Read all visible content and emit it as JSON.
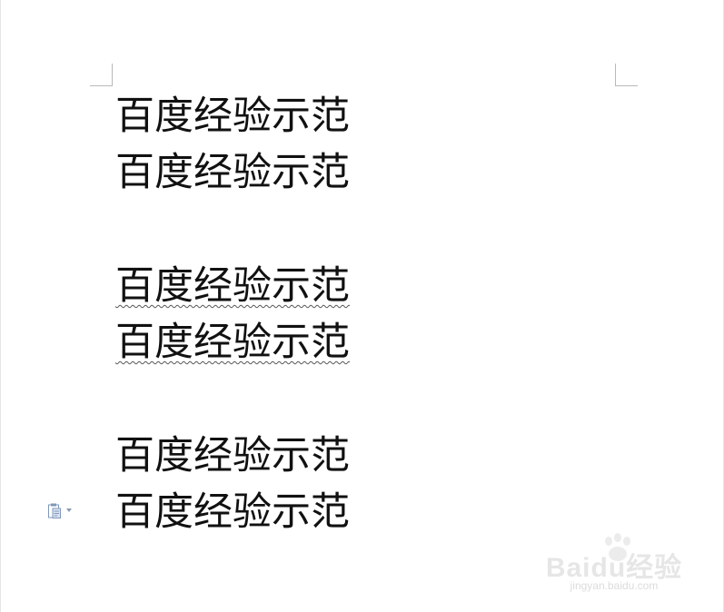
{
  "document": {
    "lines": [
      {
        "text": "百度经验示范",
        "spellcheck_underline": false
      },
      {
        "text": "百度经验示范",
        "spellcheck_underline": false
      },
      {
        "text": "百度经验示范",
        "spellcheck_underline": true
      },
      {
        "text": "百度经验示范",
        "spellcheck_underline": true
      },
      {
        "text": "百度经验示范",
        "spellcheck_underline": false
      },
      {
        "text": "百度经验示范",
        "spellcheck_underline": false
      }
    ]
  },
  "paste_options": {
    "icon": "clipboard-paste-icon",
    "dropdown_icon": "caret-down-icon"
  },
  "watermark": {
    "logo_text": "Baidu经验",
    "url": "jingyan.baidu.com"
  },
  "colors": {
    "text": "#111111",
    "squiggle": "#555555",
    "corner_marks": "#b9b9b9",
    "paste_icon": "#7f97b8"
  }
}
